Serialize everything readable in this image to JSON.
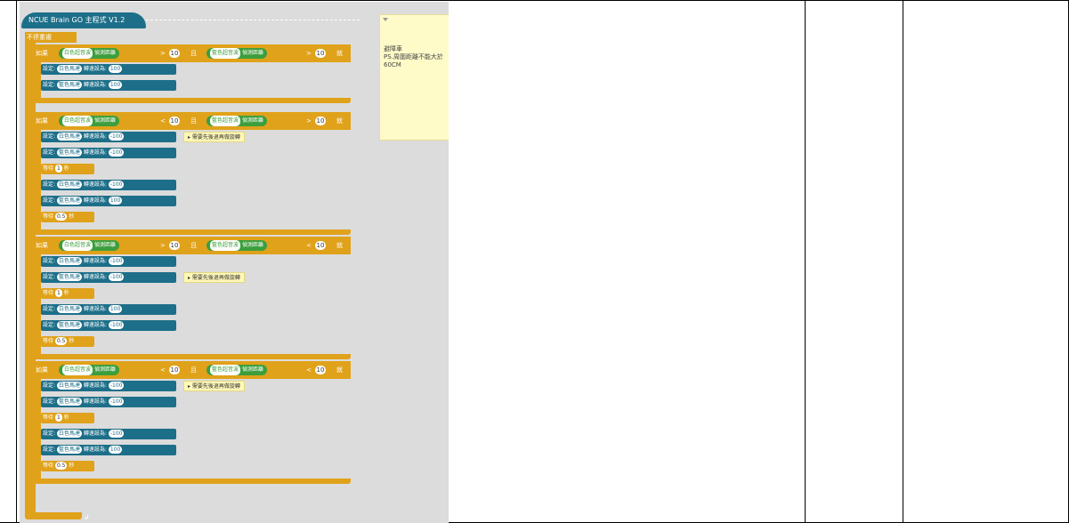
{
  "program": {
    "title": "NCUE Brain GO 主程式 V1.2",
    "loop_label": "不停重複"
  },
  "comment_note": "避障車\nPS.周圍距離不能大於\n60CM",
  "colors": {
    "control": "#e0a21a",
    "sensor": "#3c9e3c",
    "motor": "#1d6f89",
    "note": "#fffbc8"
  },
  "if_labels": {
    "if": "如果",
    "and": "且",
    "then": "就"
  },
  "conditions": [
    {
      "left_sensor": "白色超音波",
      "left_prop": "偵測距離",
      "left_op": ">",
      "left_val": "10",
      "right_sensor": "藍色超音波",
      "right_prop": "偵測距離",
      "right_op": ">",
      "right_val": "10",
      "steps": [
        {
          "type": "set",
          "label": "設定:",
          "motor": "白色馬達",
          "prop": "轉速設為:",
          "value": "100"
        },
        {
          "type": "set",
          "label": "設定:",
          "motor": "藍色馬達",
          "prop": "轉速設為:",
          "value": "100"
        }
      ]
    },
    {
      "left_sensor": "白色超音波",
      "left_prop": "偵測距離",
      "left_op": "<",
      "left_val": "10",
      "right_sensor": "藍色超音波",
      "right_prop": "偵測距離",
      "right_op": ">",
      "right_val": "10",
      "steps": [
        {
          "type": "set",
          "label": "設定:",
          "motor": "白色馬達",
          "prop": "轉速設為:",
          "value": "-100",
          "comment": "需要先後退再做旋轉"
        },
        {
          "type": "set",
          "label": "設定:",
          "motor": "藍色馬達",
          "prop": "轉速設為:",
          "value": "-100"
        },
        {
          "type": "wait",
          "label": "等待",
          "value": "1",
          "unit": "秒"
        },
        {
          "type": "set",
          "label": "設定:",
          "motor": "白色馬達",
          "prop": "轉速設為:",
          "value": "-100"
        },
        {
          "type": "set",
          "label": "設定:",
          "motor": "藍色馬達",
          "prop": "轉速設為:",
          "value": "100"
        },
        {
          "type": "wait",
          "label": "等待",
          "value": "0.5",
          "unit": "秒"
        }
      ]
    },
    {
      "left_sensor": "白色超音波",
      "left_prop": "偵測距離",
      "left_op": ">",
      "left_val": "10",
      "right_sensor": "藍色超音波",
      "right_prop": "偵測距離",
      "right_op": "<",
      "right_val": "10",
      "steps": [
        {
          "type": "set",
          "label": "設定:",
          "motor": "白色馬達",
          "prop": "轉速設為:",
          "value": "-100"
        },
        {
          "type": "set",
          "label": "設定:",
          "motor": "藍色馬達",
          "prop": "轉速設為:",
          "value": "-100",
          "comment": "需要先後退再做旋轉"
        },
        {
          "type": "wait",
          "label": "等待",
          "value": "1",
          "unit": "秒"
        },
        {
          "type": "set",
          "label": "設定:",
          "motor": "白色馬達",
          "prop": "轉速設為:",
          "value": "100"
        },
        {
          "type": "set",
          "label": "設定:",
          "motor": "藍色馬達",
          "prop": "轉速設為:",
          "value": "-100"
        },
        {
          "type": "wait",
          "label": "等待",
          "value": "0.5",
          "unit": "秒"
        }
      ]
    },
    {
      "left_sensor": "白色超音波",
      "left_prop": "偵測距離",
      "left_op": "<",
      "left_val": "10",
      "right_sensor": "藍色超音波",
      "right_prop": "偵測距離",
      "right_op": "<",
      "right_val": "10",
      "steps": [
        {
          "type": "set",
          "label": "設定:",
          "motor": "白色馬達",
          "prop": "轉速設為:",
          "value": "-100",
          "comment": "需要先後退再做旋轉"
        },
        {
          "type": "set",
          "label": "設定:",
          "motor": "藍色馬達",
          "prop": "轉速設為:",
          "value": "-100"
        },
        {
          "type": "wait",
          "label": "等待",
          "value": "1",
          "unit": "秒"
        },
        {
          "type": "set",
          "label": "設定:",
          "motor": "白色馬達",
          "prop": "轉速設為:",
          "value": "-100"
        },
        {
          "type": "set",
          "label": "設定:",
          "motor": "藍色馬達",
          "prop": "轉速設為:",
          "value": "100"
        },
        {
          "type": "wait",
          "label": "等待",
          "value": "0.5",
          "unit": "秒"
        }
      ]
    }
  ]
}
